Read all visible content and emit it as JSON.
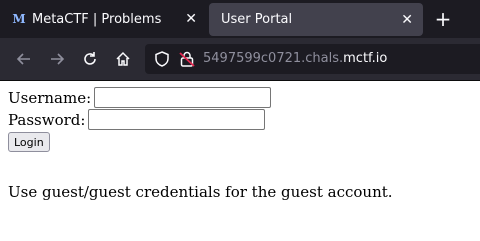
{
  "browser": {
    "tabs": [
      {
        "title": "MetaCTF | Problems",
        "favicon": "M",
        "active": false
      },
      {
        "title": "User Portal",
        "active": true
      }
    ],
    "url": {
      "subdomain": "5497599c0721.chals.",
      "domain": "mctf.io"
    }
  },
  "form": {
    "username_label": "Username:",
    "username_value": "",
    "password_label": "Password:",
    "password_value": "",
    "login_label": "Login"
  },
  "hint": "Use guest/guest credentials for the guest account.",
  "colors": {
    "tabbar": "#1c1b22",
    "navbar": "#2b2a33",
    "active_tab": "#42414d",
    "lock_warning": "#e22850"
  },
  "icons": [
    "back-arrow-icon",
    "forward-arrow-icon",
    "reload-icon",
    "home-icon",
    "shield-icon",
    "insecure-lock-icon",
    "close-icon",
    "plus-icon"
  ]
}
